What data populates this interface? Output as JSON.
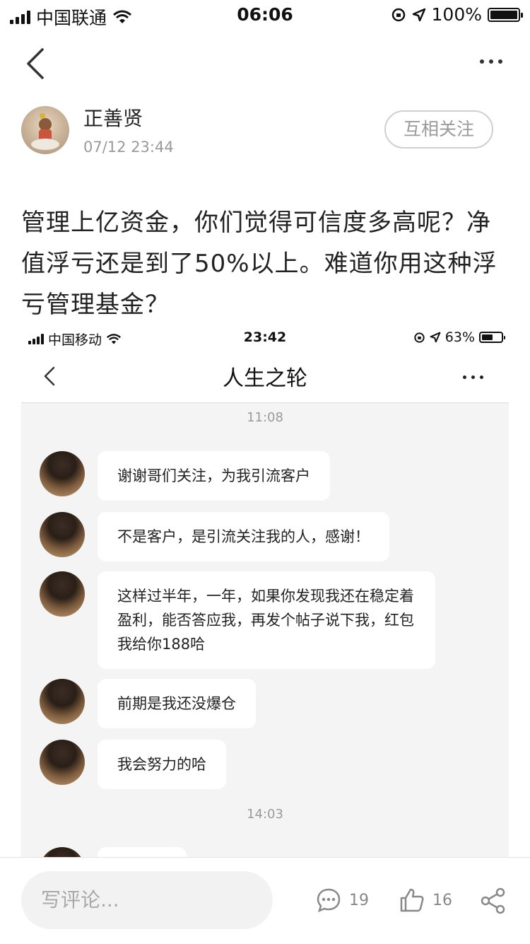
{
  "status_bar": {
    "carrier": "中国联通",
    "time": "06:06",
    "battery": "100%",
    "battery_level": 1.0
  },
  "author": {
    "name": "正善贤",
    "time": "07/12 23:44",
    "follow_label": "互相关注"
  },
  "post": {
    "text": "管理上亿资金，你们觉得可信度多高呢？净值浮亏还是到了50%以上。难道你用这种浮亏管理基金？"
  },
  "screenshot": {
    "status": {
      "carrier": "中国移动",
      "time": "23:42",
      "battery": "63%",
      "battery_level": 0.63
    },
    "title": "人生之轮",
    "timestamps": [
      "11:08",
      "14:03"
    ],
    "messages": [
      {
        "text": "谢谢哥们关注，为我引流客户"
      },
      {
        "text": "不是客户，是引流关注我的人，感谢！"
      },
      {
        "text": "这样过半年，一年，如果你发现我还在稳定着盈利，能否答应我，再发个帖子说下我，红包我给你188哈"
      },
      {
        "text": "前期是我还没爆仓"
      },
      {
        "text": "我会努力的哈"
      }
    ]
  },
  "bottom_bar": {
    "comment_placeholder": "写评论...",
    "comments_count": "19",
    "likes_count": "16"
  },
  "icons": [
    "back-icon",
    "more-icon",
    "comment-icon",
    "like-icon",
    "share-icon",
    "wifi-icon",
    "location-icon",
    "orientation-lock-icon"
  ]
}
